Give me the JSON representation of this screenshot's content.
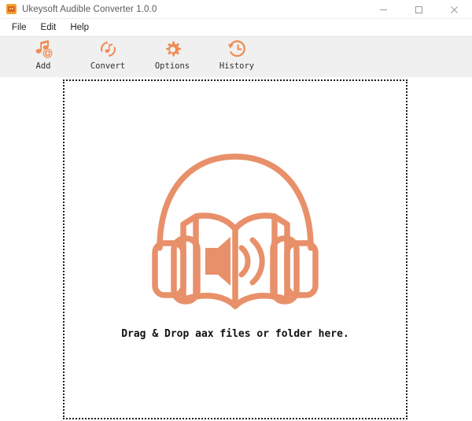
{
  "window": {
    "title": "Ukeysoft Audible Converter 1.0.0",
    "app_icon": "app-logo-icon",
    "controls": [
      {
        "name": "minimize-button",
        "glyph": "minimize-icon"
      },
      {
        "name": "maximize-button",
        "glyph": "maximize-icon"
      },
      {
        "name": "close-button",
        "glyph": "close-icon"
      }
    ]
  },
  "menubar": {
    "items": [
      {
        "label": "File"
      },
      {
        "label": "Edit"
      },
      {
        "label": "Help"
      }
    ]
  },
  "toolbar": {
    "buttons": [
      {
        "label": "Add",
        "icon": "music-note-add-icon"
      },
      {
        "label": "Convert",
        "icon": "convert-refresh-note-icon"
      },
      {
        "label": "Options",
        "icon": "gear-icon"
      },
      {
        "label": "History",
        "icon": "clock-history-icon"
      }
    ]
  },
  "dropzone": {
    "logo_icon": "headphones-audiobook-icon",
    "message": "Drag & Drop aax files or folder here."
  },
  "colors": {
    "accent": "#ef8c54",
    "logo": "#e8906a",
    "toolbar_bg": "#f0f0f0",
    "title_text": "#5a5a5a",
    "dropzone_border": "#1d1d1d"
  }
}
